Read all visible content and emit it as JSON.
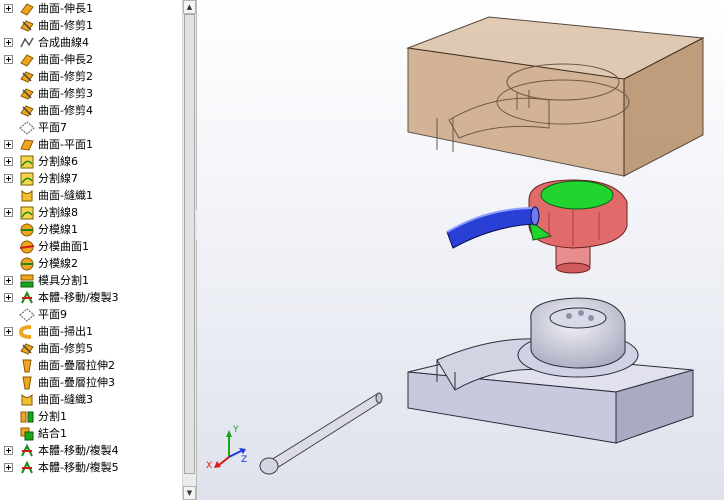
{
  "tree": {
    "items": [
      {
        "label": "曲面-伸長1",
        "icon": "surface-extrude-icon",
        "expander": true
      },
      {
        "label": "曲面-修剪1",
        "icon": "surface-trim-icon",
        "expander": false
      },
      {
        "label": "合成曲線4",
        "icon": "composite-curve-icon",
        "expander": true
      },
      {
        "label": "曲面-伸長2",
        "icon": "surface-extrude-icon",
        "expander": true
      },
      {
        "label": "曲面-修剪2",
        "icon": "surface-trim-icon",
        "expander": false
      },
      {
        "label": "曲面-修剪3",
        "icon": "surface-trim-icon",
        "expander": false
      },
      {
        "label": "曲面-修剪4",
        "icon": "surface-trim-icon",
        "expander": false
      },
      {
        "label": "平面7",
        "icon": "plane-icon",
        "expander": false
      },
      {
        "label": "曲面-平面1",
        "icon": "planar-surface-icon",
        "expander": true
      },
      {
        "label": "分割線6",
        "icon": "split-line-icon",
        "expander": true
      },
      {
        "label": "分割線7",
        "icon": "split-line-icon",
        "expander": true
      },
      {
        "label": "曲面-縫織1",
        "icon": "knit-surface-icon",
        "expander": false
      },
      {
        "label": "分割線8",
        "icon": "split-line-icon",
        "expander": true
      },
      {
        "label": "分模線1",
        "icon": "parting-line-icon",
        "expander": false
      },
      {
        "label": "分模曲面1",
        "icon": "parting-surface-icon",
        "expander": false
      },
      {
        "label": "分模線2",
        "icon": "parting-line-icon",
        "expander": false
      },
      {
        "label": "模具分割1",
        "icon": "tooling-split-icon",
        "expander": true
      },
      {
        "label": "本體-移動/複製3",
        "icon": "move-copy-body-icon",
        "expander": true
      },
      {
        "label": "平面9",
        "icon": "plane-icon",
        "expander": false
      },
      {
        "label": "曲面-掃出1",
        "icon": "surface-sweep-icon",
        "expander": true
      },
      {
        "label": "曲面-修剪5",
        "icon": "surface-trim-icon",
        "expander": false
      },
      {
        "label": "曲面-疊層拉伸2",
        "icon": "surface-loft-icon",
        "expander": false
      },
      {
        "label": "曲面-疊層拉伸3",
        "icon": "surface-loft-icon",
        "expander": false
      },
      {
        "label": "曲面-縫織3",
        "icon": "knit-surface-icon",
        "expander": false
      },
      {
        "label": "分割1",
        "icon": "split-icon",
        "expander": false
      },
      {
        "label": "結合1",
        "icon": "combine-icon",
        "expander": false
      },
      {
        "label": "本體-移動/複製4",
        "icon": "move-copy-body-icon",
        "expander": true
      },
      {
        "label": "本體-移動/複製5",
        "icon": "move-copy-body-icon",
        "expander": true
      }
    ]
  },
  "triad": {
    "x_label": "X",
    "y_label": "Y",
    "z_label": "Z"
  },
  "colors": {
    "cavity": "#c9a27c",
    "core": "#c8c9dd",
    "core_edge": "#2b2b3b",
    "insert_red": "#e16b6b",
    "insert_green": "#22d42e",
    "runner_blue": "#2a3fd6",
    "viewport_top": "#ffffff",
    "viewport_bottom": "#dfe2ec"
  }
}
